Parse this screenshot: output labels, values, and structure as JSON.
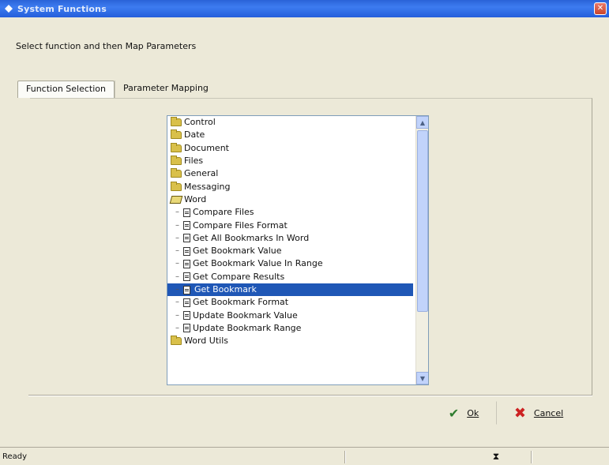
{
  "window": {
    "title": "System Functions",
    "close_glyph": "✕"
  },
  "prompt": "Select function and then Map Parameters",
  "tabs": [
    {
      "label": "Function Selection",
      "active": true
    },
    {
      "label": "Parameter Mapping",
      "active": false
    }
  ],
  "tree": {
    "items": [
      {
        "label": "Control",
        "type": "folder"
      },
      {
        "label": "Date",
        "type": "folder"
      },
      {
        "label": "Document",
        "type": "folder"
      },
      {
        "label": "Files",
        "type": "folder"
      },
      {
        "label": "General",
        "type": "folder"
      },
      {
        "label": "Messaging",
        "type": "folder"
      },
      {
        "label": "Word",
        "type": "open-folder"
      },
      {
        "label": "Compare Files",
        "type": "function"
      },
      {
        "label": "Compare Files Format",
        "type": "function"
      },
      {
        "label": "Get All Bookmarks In Word",
        "type": "function"
      },
      {
        "label": "Get Bookmark Value",
        "type": "function"
      },
      {
        "label": "Get Bookmark Value In Range",
        "type": "function"
      },
      {
        "label": "Get Compare Results",
        "type": "function"
      },
      {
        "label": "Get Bookmark",
        "type": "function",
        "selected": true
      },
      {
        "label": "Get Bookmark Format",
        "type": "function"
      },
      {
        "label": "Update Bookmark Value",
        "type": "function"
      },
      {
        "label": "Update Bookmark Range",
        "type": "function"
      },
      {
        "label": "Word Utils",
        "type": "folder"
      }
    ]
  },
  "buttons": {
    "ok": "Ok",
    "cancel": "Cancel"
  },
  "status": {
    "text": "Ready"
  }
}
